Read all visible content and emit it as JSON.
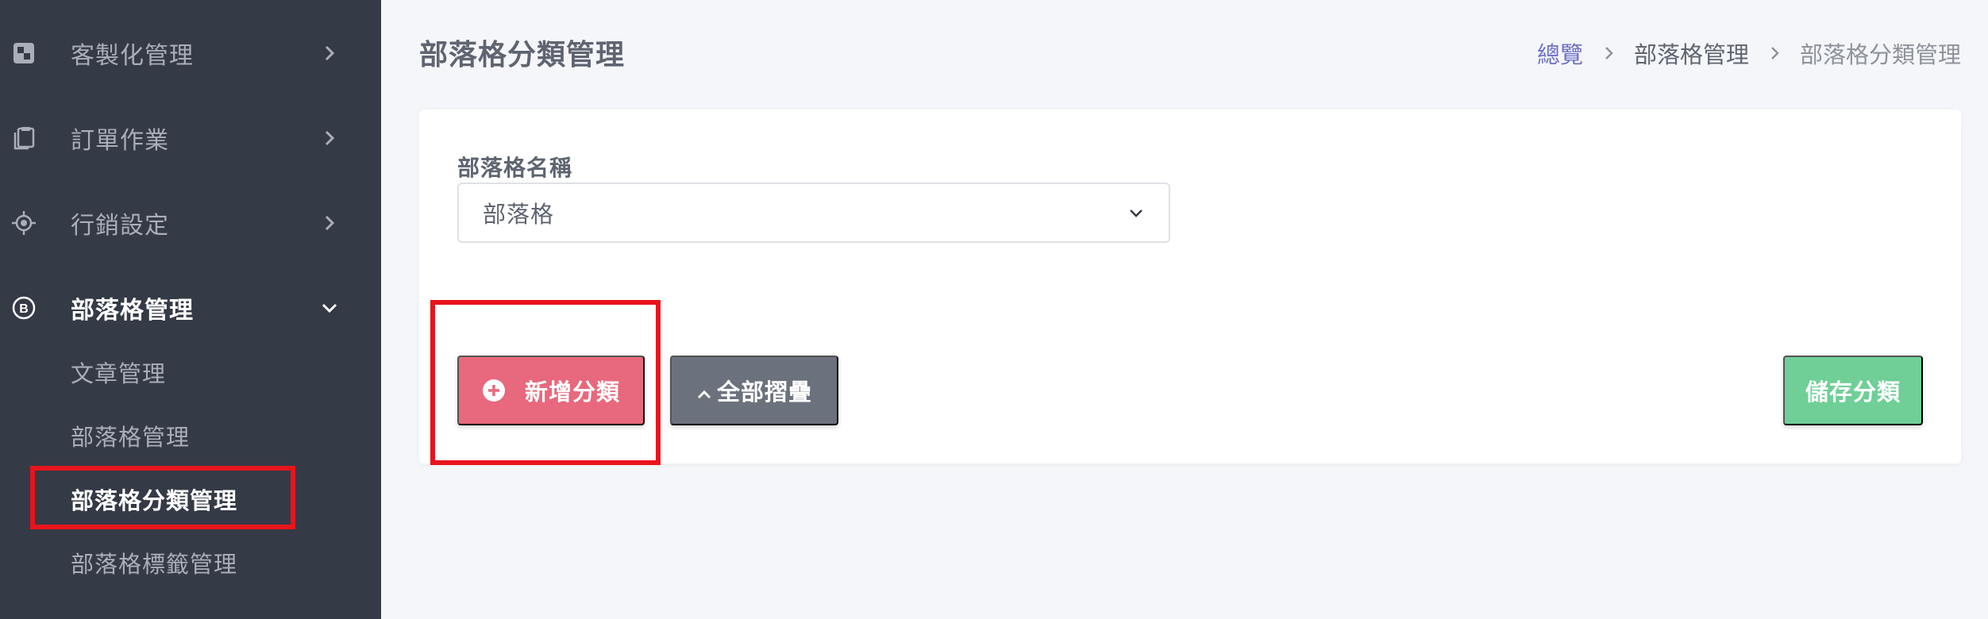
{
  "sidebar": {
    "items": [
      {
        "label": "客製化管理",
        "icon": "customize-icon"
      },
      {
        "label": "訂單作業",
        "icon": "clipboard-icon"
      },
      {
        "label": "行銷設定",
        "icon": "target-icon"
      },
      {
        "label": "部落格管理",
        "icon": "blog-b-icon"
      }
    ],
    "subitems": [
      {
        "label": "文章管理"
      },
      {
        "label": "部落格管理"
      },
      {
        "label": "部落格分類管理"
      },
      {
        "label": "部落格標籤管理"
      }
    ]
  },
  "header": {
    "title": "部落格分類管理",
    "breadcrumb": [
      "總覽",
      "部落格管理",
      "部落格分類管理"
    ]
  },
  "form": {
    "field_label": "部落格名稱",
    "select_value": "部落格"
  },
  "actions": {
    "add_label": "新增分類",
    "collapse_label": "全部摺疊",
    "save_label": "儲存分類"
  },
  "colors": {
    "sidebar_bg": "#343a46",
    "add_button": "#e8687d",
    "collapse_button": "#6c727d",
    "save_button": "#6fcf97",
    "breadcrumb_link": "#6c70c8",
    "highlight": "#e8141c"
  }
}
